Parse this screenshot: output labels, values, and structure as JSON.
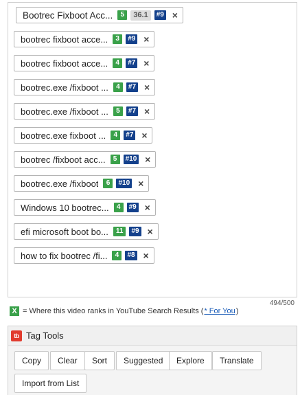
{
  "tags": [
    {
      "text": "Bootrec Fixboot Acc...",
      "rank": "5",
      "score": "36.1",
      "pos": "#9"
    },
    {
      "text": "bootrec fixboot acce...",
      "rank": "3",
      "pos": "#9"
    },
    {
      "text": "bootrec fixboot acce...",
      "rank": "4",
      "pos": "#7"
    },
    {
      "text": "bootrec.exe /fixboot ...",
      "rank": "4",
      "pos": "#7"
    },
    {
      "text": "bootrec.exe /fixboot ...",
      "rank": "5",
      "pos": "#7"
    },
    {
      "text": "bootrec.exe fixboot ...",
      "rank": "4",
      "pos": "#7"
    },
    {
      "text": "bootrec /fixboot acc...",
      "rank": "5",
      "pos": "#10"
    },
    {
      "text": "bootrec.exe /fixboot",
      "rank": "6",
      "pos": "#10"
    },
    {
      "text": "Windows 10 bootrec...",
      "rank": "4",
      "pos": "#9"
    },
    {
      "text": "efi microsoft boot bo...",
      "rank": "11",
      "pos": "#9"
    },
    {
      "text": "how to fix bootrec /fi...",
      "rank": "4",
      "pos": "#8"
    }
  ],
  "remove_glyph": "×",
  "counter": "494/500",
  "legend": {
    "badge": "X",
    "text": "= Where this video ranks in YouTube Search Results (",
    "link": "* For You",
    "close": ")"
  },
  "tools": {
    "logo": "tb",
    "title": "Tag Tools",
    "buttons": {
      "copy": "Copy",
      "clear": "Clear",
      "sort": "Sort",
      "suggested": "Suggested",
      "explore": "Explore",
      "translate": "Translate",
      "import": "Import from List"
    }
  },
  "colors": {
    "rank_badge": "#3aa14a",
    "position_badge": "#14418c",
    "logo": "#e13b2e"
  }
}
